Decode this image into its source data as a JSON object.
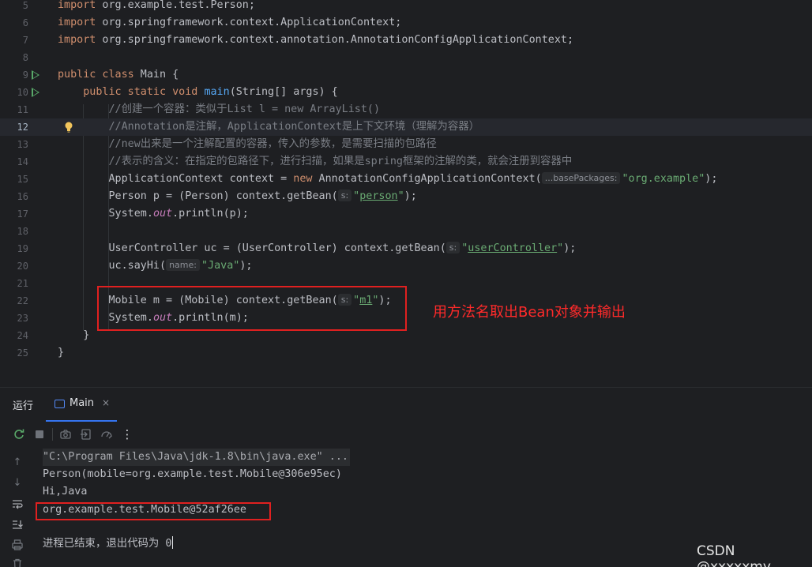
{
  "editor": {
    "lines": [
      {
        "num": "5",
        "segments": [
          {
            "t": "import",
            "c": "kw"
          },
          {
            "t": " org.example.test.Person;"
          }
        ]
      },
      {
        "num": "6",
        "segments": [
          {
            "t": "import",
            "c": "kw"
          },
          {
            "t": " org.springframework.context.ApplicationContext;"
          }
        ]
      },
      {
        "num": "7",
        "segments": [
          {
            "t": "import",
            "c": "kw"
          },
          {
            "t": " org.springframework.context.annotation.AnnotationConfigApplicationContext;"
          }
        ]
      },
      {
        "num": "8",
        "segments": []
      },
      {
        "num": "9",
        "run": true,
        "segments": [
          {
            "t": "public class",
            "c": "kw"
          },
          {
            "t": " Main {"
          }
        ]
      },
      {
        "num": "10",
        "run": true,
        "segments": [
          {
            "t": "    "
          },
          {
            "t": "public static void",
            "c": "kw"
          },
          {
            "t": " "
          },
          {
            "t": "main",
            "c": "fn"
          },
          {
            "t": "(String[] args) {"
          }
        ]
      },
      {
        "num": "11",
        "segments": [
          {
            "t": "        "
          },
          {
            "t": "//创建一个容器：类似于List l = new ArrayList()",
            "c": "cmt"
          }
        ]
      },
      {
        "num": "12",
        "current": true,
        "bulb": true,
        "segments": [
          {
            "t": "        "
          },
          {
            "t": "//Annotation是注解，ApplicationContext是上下文环境（理解为容器）",
            "c": "cmt"
          }
        ]
      },
      {
        "num": "13",
        "segments": [
          {
            "t": "        "
          },
          {
            "t": "//new出来是一个注解配置的容器，传入的参数，是需要扫描的包路径",
            "c": "cmt"
          }
        ]
      },
      {
        "num": "14",
        "segments": [
          {
            "t": "        "
          },
          {
            "t": "//表示的含义：在指定的包路径下，进行扫描，如果是spring框架的注解的类，就会注册到容器中",
            "c": "cmt"
          }
        ]
      },
      {
        "num": "15",
        "segments": [
          {
            "t": "        ApplicationContext context = "
          },
          {
            "t": "new",
            "c": "kw"
          },
          {
            "t": " AnnotationConfigApplicationContext("
          },
          {
            "t": "...basePackages:",
            "c": "hint"
          },
          {
            "t": "\"org.example\"",
            "c": "str"
          },
          {
            "t": ");"
          }
        ]
      },
      {
        "num": "16",
        "segments": [
          {
            "t": "        Person p = (Person) context.getBean("
          },
          {
            "t": "s:",
            "c": "hint"
          },
          {
            "t": "\"",
            "c": "str"
          },
          {
            "t": "person",
            "c": "strlink"
          },
          {
            "t": "\"",
            "c": "str"
          },
          {
            "t": ");"
          }
        ]
      },
      {
        "num": "17",
        "segments": [
          {
            "t": "        System."
          },
          {
            "t": "out",
            "c": "static"
          },
          {
            "t": ".println(p);"
          }
        ]
      },
      {
        "num": "18",
        "segments": []
      },
      {
        "num": "19",
        "segments": [
          {
            "t": "        UserController uc = (UserController) context.getBean("
          },
          {
            "t": "s:",
            "c": "hint"
          },
          {
            "t": "\"",
            "c": "str"
          },
          {
            "t": "userController",
            "c": "strlink"
          },
          {
            "t": "\"",
            "c": "str"
          },
          {
            "t": ");"
          }
        ]
      },
      {
        "num": "20",
        "segments": [
          {
            "t": "        uc.sayHi("
          },
          {
            "t": "name:",
            "c": "hint"
          },
          {
            "t": "\"Java\"",
            "c": "str"
          },
          {
            "t": ");"
          }
        ]
      },
      {
        "num": "21",
        "segments": []
      },
      {
        "num": "22",
        "segments": [
          {
            "t": "        Mobile m = (Mobile) context.getBean("
          },
          {
            "t": "s:",
            "c": "hint"
          },
          {
            "t": "\"",
            "c": "str"
          },
          {
            "t": "m1",
            "c": "strlink"
          },
          {
            "t": "\"",
            "c": "str"
          },
          {
            "t": ");"
          }
        ]
      },
      {
        "num": "23",
        "segments": [
          {
            "t": "        System."
          },
          {
            "t": "out",
            "c": "static"
          },
          {
            "t": ".println(m);"
          }
        ]
      },
      {
        "num": "24",
        "segments": [
          {
            "t": "    }"
          }
        ]
      },
      {
        "num": "25",
        "segments": [
          {
            "t": "}"
          }
        ]
      }
    ],
    "annotation": "用方法名取出Bean对象并输出"
  },
  "run_panel": {
    "tab_run_label": "运行",
    "tab_main_label": "Main",
    "tab_close": "×"
  },
  "toolbar_icons": [
    "rerun-icon",
    "stop-icon",
    "camera-icon",
    "exit-icon",
    "settings-icon",
    "more-icon"
  ],
  "console": {
    "command": "\"C:\\Program Files\\Java\\jdk-1.8\\bin\\java.exe\" ...",
    "output": [
      "Person(mobile=org.example.test.Mobile@306e95ec)",
      "Hi,Java",
      "org.example.test.Mobile@52af26ee"
    ],
    "exit_message": "进程已结束，退出代码为 0"
  },
  "watermark": "CSDN @xxxxxmy"
}
